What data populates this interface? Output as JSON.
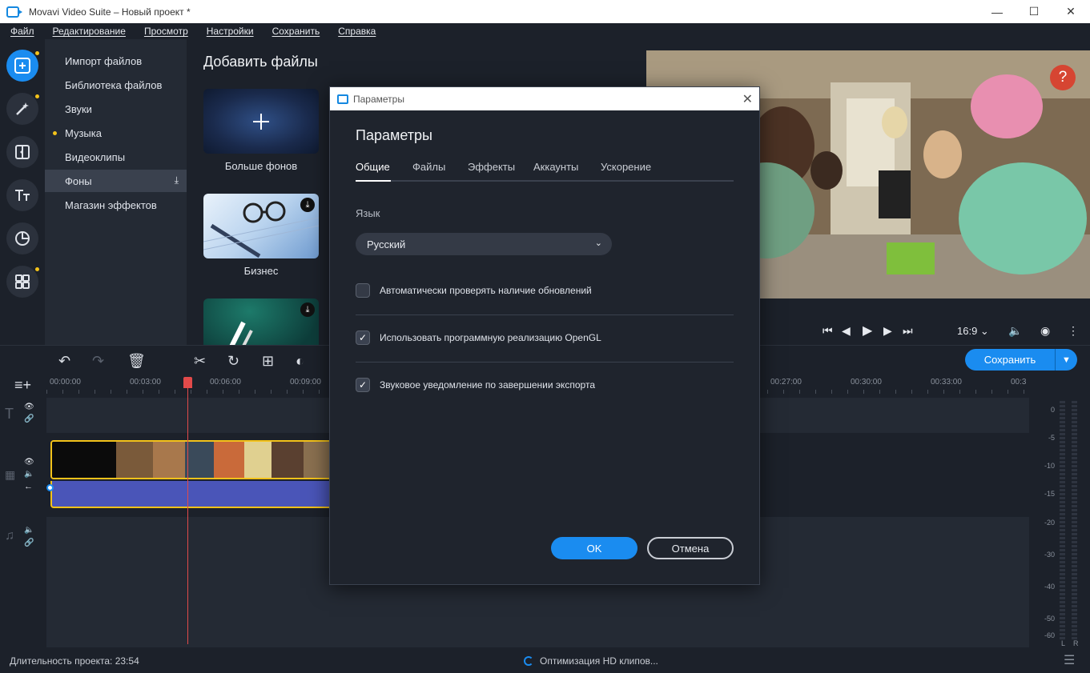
{
  "window": {
    "title": "Movavi Video Suite – Новый проект *"
  },
  "menu": [
    "Файл",
    "Редактирование",
    "Просмотр",
    "Настройки",
    "Сохранить",
    "Справка"
  ],
  "left_tools": [
    "import-icon",
    "magic-wand-icon",
    "transitions-icon",
    "titles-icon",
    "filters-icon",
    "more-tools-icon"
  ],
  "categories": [
    {
      "label": "Импорт файлов"
    },
    {
      "label": "Библиотека файлов"
    },
    {
      "label": "Звуки"
    },
    {
      "label": "Музыка"
    },
    {
      "label": "Видеоклипы"
    },
    {
      "label": "Фоны"
    },
    {
      "label": "Магазин эффектов"
    }
  ],
  "content": {
    "heading": "Добавить файлы",
    "tiles": [
      {
        "label": "Больше фонов",
        "icon": "plus-icon"
      },
      {
        "label": "Бизнес",
        "icon": "download-icon"
      },
      {
        "label": "",
        "icon": "download-icon"
      }
    ]
  },
  "player": {
    "help": "?",
    "aspect": "16:9"
  },
  "timeline": {
    "ticks": [
      "00:00:00",
      "00:03:00",
      "00:06:00",
      "00:09:00",
      "00:27:00",
      "00:30:00",
      "00:33:00",
      "00:3"
    ],
    "save_label": "Сохранить"
  },
  "meter": {
    "levels": [
      "0",
      "-5",
      "-10",
      "-15",
      "-20",
      "-30",
      "-40",
      "-50",
      "-60"
    ],
    "channels": [
      "L",
      "R"
    ]
  },
  "status": {
    "duration": "Длительность проекта: 23:54",
    "optimizing": "Оптимизация HD клипов..."
  },
  "dialog": {
    "window_title": "Параметры",
    "heading": "Параметры",
    "tabs": [
      "Общие",
      "Файлы",
      "Эффекты",
      "Аккаунты",
      "Ускорение"
    ],
    "language_label": "Язык",
    "language_value": "Русский",
    "options": [
      {
        "label": "Автоматически проверять наличие обновлений",
        "checked": false
      },
      {
        "label": "Использовать программную реализацию OpenGL",
        "checked": true
      },
      {
        "label": "Звуковое уведомление по завершении экспорта",
        "checked": true
      }
    ],
    "ok": "OK",
    "cancel": "Отмена"
  },
  "colors": {
    "accent": "#1a8cf0",
    "highlight": "#f3c21a",
    "playhead": "#e24a4a",
    "audio_clip": "#4a55b8"
  }
}
